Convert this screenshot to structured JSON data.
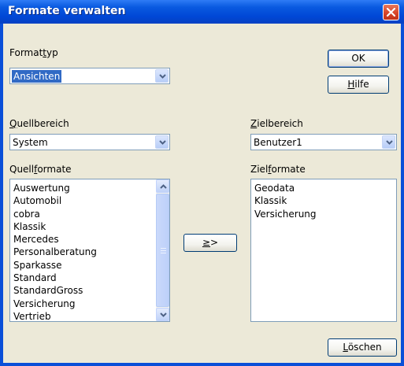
{
  "window": {
    "title": "Formate verwalten"
  },
  "formattyp": {
    "label_pre": "Format",
    "label_key": "t",
    "label_post": "yp",
    "value": "Ansichten"
  },
  "buttons": {
    "ok": "OK",
    "hilfe_key": "H",
    "hilfe_rest": "ilfe",
    "transfer_key": "≥",
    "transfer_rest": ">",
    "loeschen_key": "L",
    "loeschen_rest": "öschen"
  },
  "quellbereich": {
    "label_key": "Q",
    "label_rest": "uellbereich",
    "value": "System"
  },
  "zielbereich": {
    "label_key": "Z",
    "label_rest": "ielbereich",
    "value": "Benutzer1"
  },
  "quellformate": {
    "label_pre": "Quell",
    "label_key": "f",
    "label_post": "ormate",
    "items": [
      "Auswertung",
      "Automobil",
      "cobra",
      "Klassik",
      "Mercedes",
      "Personalberatung",
      "Sparkasse",
      "Standard",
      "StandardGross",
      "Versicherung",
      "Vertrieb"
    ]
  },
  "zielformate": {
    "label_pre": "Ziel",
    "label_key": "f",
    "label_post": "ormate",
    "items": [
      "Geodata",
      "Klassik",
      "Versicherung"
    ]
  },
  "colors": {
    "titlebar": "#0a5ae0",
    "client": "#ece9d8",
    "selection": "#316ac5",
    "close": "#d8452a"
  }
}
